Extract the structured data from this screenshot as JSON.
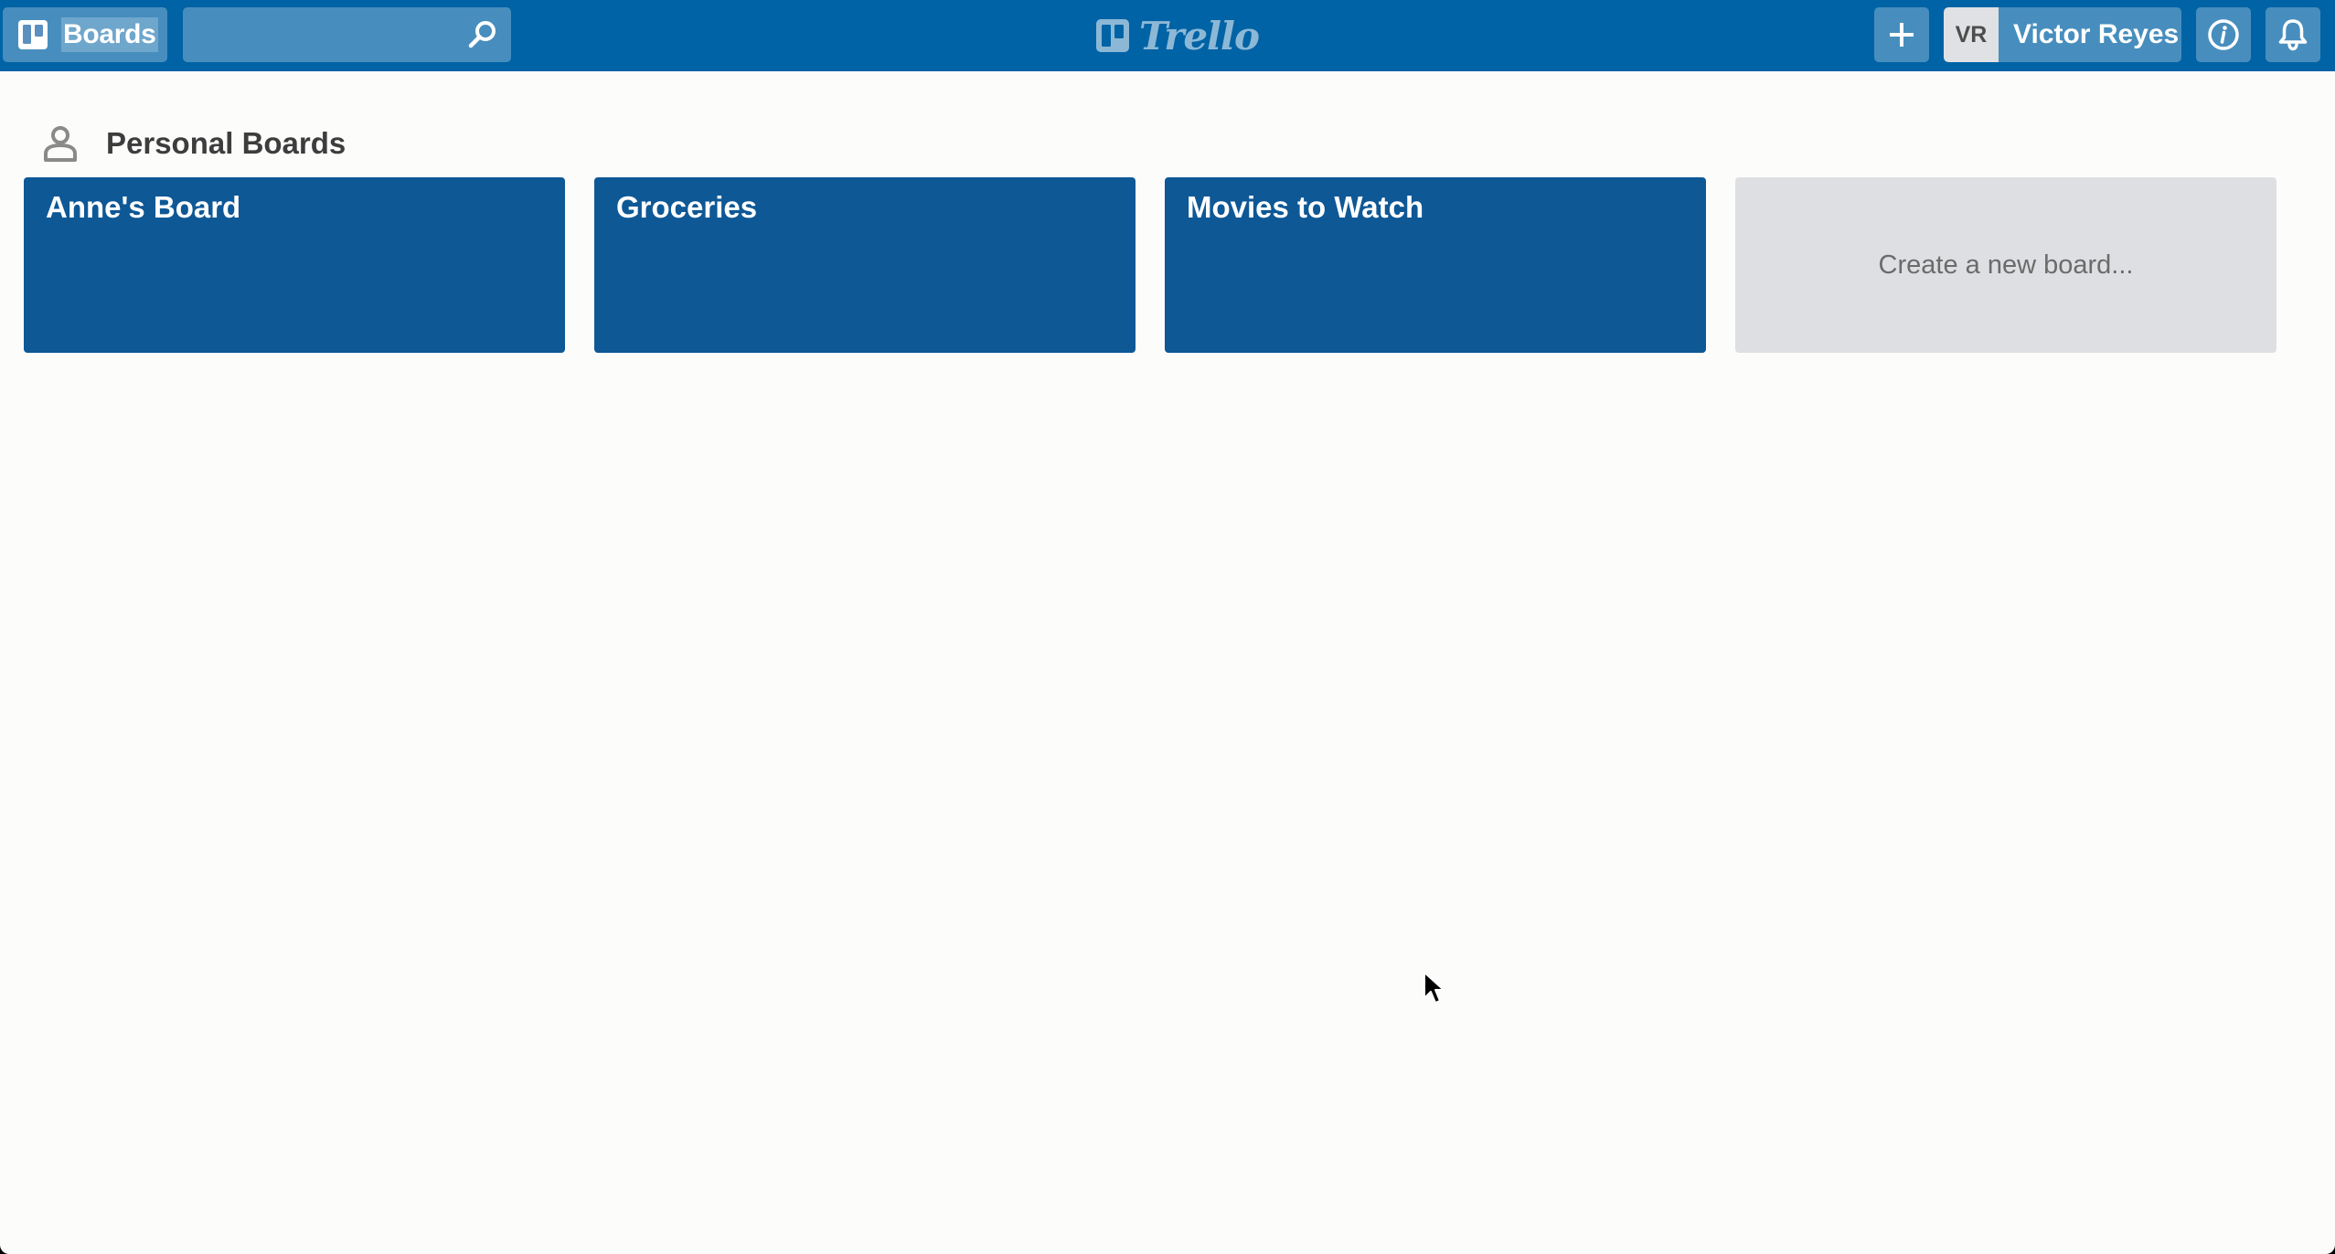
{
  "header": {
    "boards_label": "Boards",
    "search": {
      "value": "",
      "placeholder": ""
    },
    "logo_text": "Trello",
    "user": {
      "initials": "VR",
      "name": "Victor Reyes"
    },
    "colors": {
      "bar": "#0063a5",
      "button": "rgba(255,255,255,0.28)"
    }
  },
  "main": {
    "section_title": "Personal Boards",
    "boards": [
      {
        "title": "Anne's Board"
      },
      {
        "title": "Groceries"
      },
      {
        "title": "Movies to Watch"
      }
    ],
    "new_board_label": "Create a new board...",
    "colors": {
      "board_tile": "#0e5896",
      "new_board_tile": "#dedfe2"
    }
  },
  "icons": {
    "boards": "boards-icon",
    "search": "search-icon",
    "logo": "trello-logo-icon",
    "add": "plus-icon",
    "info": "info-icon",
    "notifications": "bell-icon",
    "section": "person-icon",
    "cursor": "mouse-cursor-icon"
  }
}
